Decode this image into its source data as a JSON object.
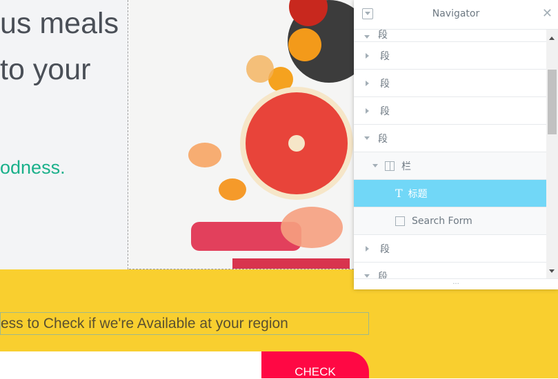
{
  "hero": {
    "line1": "us meals",
    "line2": "to your",
    "tagline": "odness."
  },
  "availability": {
    "prompt": "ess to Check if we're Available at your region",
    "address_value": "",
    "button": "CHECK"
  },
  "navigator": {
    "title": "Navigator",
    "items": [
      {
        "label": "段",
        "state": "collapsed",
        "level": 0
      },
      {
        "label": "段",
        "state": "collapsed",
        "level": 0
      },
      {
        "label": "段",
        "state": "collapsed",
        "level": 0
      },
      {
        "label": "段",
        "state": "collapsed",
        "level": 0
      },
      {
        "label": "段",
        "state": "expanded",
        "level": 0
      },
      {
        "label": "栏",
        "state": "expanded",
        "level": 1,
        "icon": "column-icon"
      },
      {
        "label": "标题",
        "level": 2,
        "icon": "heading-icon",
        "selected": true
      },
      {
        "label": "Search Form",
        "level": 2,
        "icon": "search-form-icon"
      },
      {
        "label": "段",
        "state": "collapsed",
        "level": 0
      },
      {
        "label": "段",
        "state": "expanded",
        "level": 0
      }
    ],
    "footer": "..."
  },
  "colors": {
    "band": "#f9cf2f",
    "button": "#ff0844",
    "selected": "#71d7f7",
    "accent_text": "#1ab08a"
  }
}
